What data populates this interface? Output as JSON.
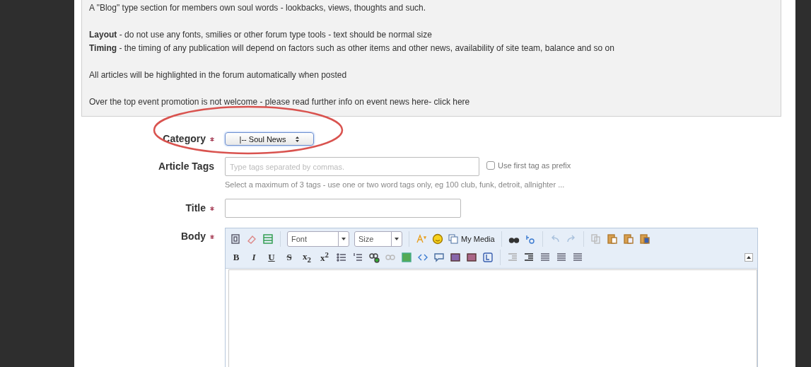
{
  "notice": {
    "lines": [
      {
        "kind": "text",
        "text": "A \"Blog\" type section for members own soul words - lookbacks, views, thoughts and such."
      },
      {
        "kind": "gap"
      },
      {
        "kind": "text",
        "text": "**Layout** - do not use any fonts, smilies or other forum type tools - text should be normal size"
      },
      {
        "kind": "text",
        "text": "**Timing** - the timing of any publication will depend on factors such as other items and other news, availability of site team, balance and so on"
      },
      {
        "kind": "gap"
      },
      {
        "kind": "text",
        "text": "All articles will be highlighted in the forum automatically when posted"
      },
      {
        "kind": "gap"
      },
      {
        "kind": "text",
        "text": "Over the top event promotion is not welcome - please read further info on event news here- click here"
      }
    ]
  },
  "form": {
    "category": {
      "label": "Category",
      "required": true,
      "value": "|-- Soul News",
      "highlighted": true
    },
    "tags": {
      "label": "Article Tags",
      "placeholder": "Type tags separated by commas.",
      "prefix_checkbox": {
        "label": "Use first tag as prefix",
        "checked": false
      },
      "hint": "Select a maximum of 3 tags - use one or two word tags only, eg 100 club, funk, detroit, allnighter ..."
    },
    "title": {
      "label": "Title",
      "required": true
    },
    "body": {
      "label": "Body",
      "required": true,
      "font_select": "Font",
      "size_select": "Size",
      "media_button": "My Media",
      "format_buttons": [
        "B",
        "I",
        "U",
        "S",
        "x$_{2}$",
        "x$^{2}$"
      ]
    }
  }
}
